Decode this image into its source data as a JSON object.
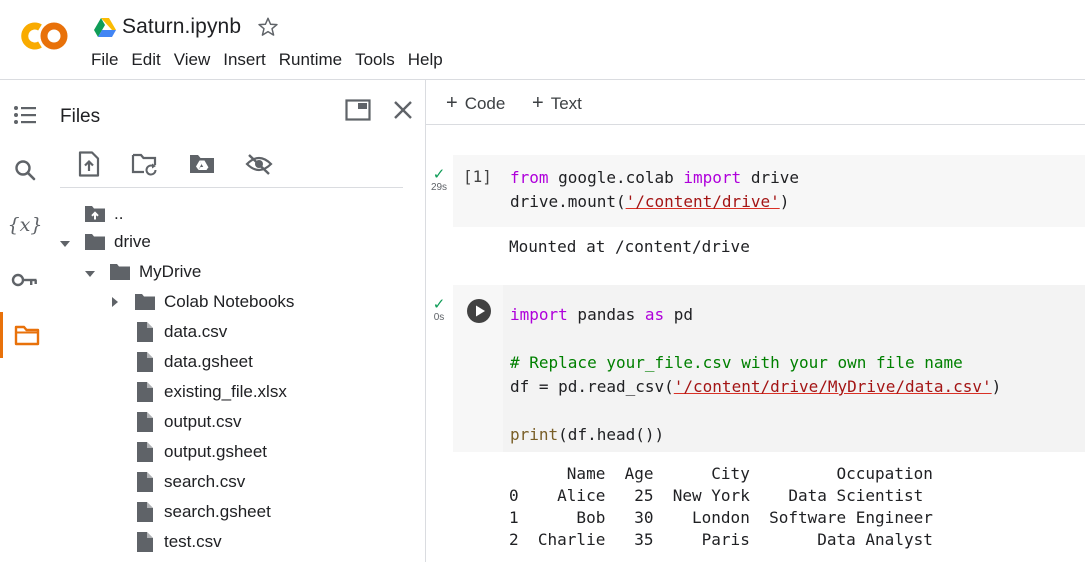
{
  "header": {
    "title": "Saturn.ipynb",
    "menu": [
      "File",
      "Edit",
      "View",
      "Insert",
      "Runtime",
      "Tools",
      "Help"
    ]
  },
  "rail": {
    "items": [
      "toc-icon",
      "search-icon",
      "variables-icon",
      "secrets-key-icon",
      "folder-icon"
    ],
    "active": "folder-icon"
  },
  "files_panel": {
    "title": "Files",
    "tree": [
      {
        "label": "..",
        "type": "parent-folder",
        "depth": 0
      },
      {
        "label": "drive",
        "type": "folder",
        "expanded": true,
        "depth": 0
      },
      {
        "label": "MyDrive",
        "type": "folder",
        "expanded": true,
        "depth": 1
      },
      {
        "label": "Colab Notebooks",
        "type": "folder",
        "expanded": false,
        "depth": 2
      },
      {
        "label": "data.csv",
        "type": "file",
        "depth": 2
      },
      {
        "label": "data.gsheet",
        "type": "file",
        "depth": 2
      },
      {
        "label": "existing_file.xlsx",
        "type": "file",
        "depth": 2
      },
      {
        "label": "output.csv",
        "type": "file",
        "depth": 2
      },
      {
        "label": "output.gsheet",
        "type": "file",
        "depth": 2
      },
      {
        "label": "search.csv",
        "type": "file",
        "depth": 2
      },
      {
        "label": "search.gsheet",
        "type": "file",
        "depth": 2
      },
      {
        "label": "test.csv",
        "type": "file",
        "depth": 2
      }
    ]
  },
  "notebook": {
    "toolbar": {
      "code_label": "Code",
      "text_label": "Text"
    },
    "cell1": {
      "exec_count": "[1]",
      "exec_time": "29s",
      "code": {
        "l1_kw1": "from",
        "l1_mid": " google.colab ",
        "l1_kw2": "import",
        "l1_end": " drive",
        "l2_pre": "drive.mount(",
        "l2_str": "'/content/drive'",
        "l2_end": ")"
      },
      "output": "Mounted at /content/drive"
    },
    "cell2": {
      "exec_time": "0s",
      "code": {
        "l1_kw1": "import",
        "l1_mid": " pandas ",
        "l1_kw2": "as",
        "l1_end": " pd",
        "comment": "# Replace your_file.csv with your own file name",
        "l3_pre": "df = pd.read_csv(",
        "l3_str": "'/content/drive/MyDrive/data.csv'",
        "l3_end": ")",
        "l5_fn": "print",
        "l5_end": "(df.head())"
      },
      "output_lines": [
        "      Name  Age      City         Occupation",
        "0    Alice   25  New York    Data Scientist",
        "1      Bob   30    London  Software Engineer",
        "2  Charlie   35     Paris       Data Analyst"
      ]
    }
  },
  "colors": {
    "accent": "#e8710a",
    "success": "#0f9d58",
    "keyword": "#af00db",
    "string": "#a31515",
    "comment": "#008000"
  }
}
